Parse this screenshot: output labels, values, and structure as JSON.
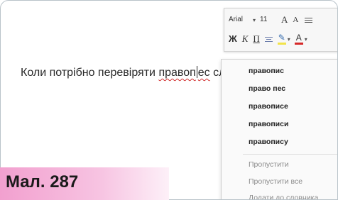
{
  "document": {
    "text_before": "Коли потрібно перевіряти ",
    "misspelled_left": "правоп",
    "misspelled_right": "ес",
    "text_after": " слів?"
  },
  "mini_toolbar": {
    "font_name": "Arial",
    "font_size": "11",
    "grow_font": "A",
    "shrink_font": "A",
    "bold": "Ж",
    "italic": "К",
    "underline": "П",
    "font_color_letter": "A"
  },
  "context_menu": {
    "suggestions": [
      "правопис",
      "право пес",
      "правописе",
      "правописи",
      "правопису"
    ],
    "actions": [
      "Пропустити",
      "Пропустити все",
      "Додати до словника"
    ]
  },
  "caption": {
    "label": "Мал. 287"
  },
  "colors": {
    "caption_pink": "#f2a0cf",
    "spell_underline": "#d23030",
    "highlight_yellow": "#f2e34a",
    "font_red": "#d62828"
  }
}
